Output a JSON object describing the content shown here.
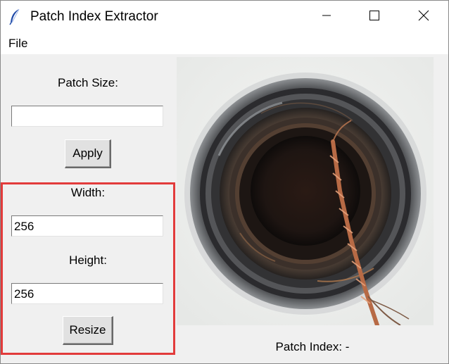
{
  "window": {
    "title": "Patch Index Extractor",
    "icon": "feather-icon",
    "controls": [
      "minimize-icon",
      "maximize-icon",
      "close-icon"
    ]
  },
  "menu": {
    "items": [
      {
        "label": "File"
      }
    ]
  },
  "left_panel": {
    "patch_size": {
      "label": "Patch Size:",
      "value": "",
      "button_label": "Apply"
    },
    "resize": {
      "width_label": "Width:",
      "width_value": "256",
      "height_label": "Height:",
      "height_value": "256",
      "button_label": "Resize"
    }
  },
  "image_panel": {
    "status": "Patch Index: -"
  },
  "colors": {
    "highlight_border": "#e23b3b",
    "window_bg": "#f0f0f0"
  }
}
